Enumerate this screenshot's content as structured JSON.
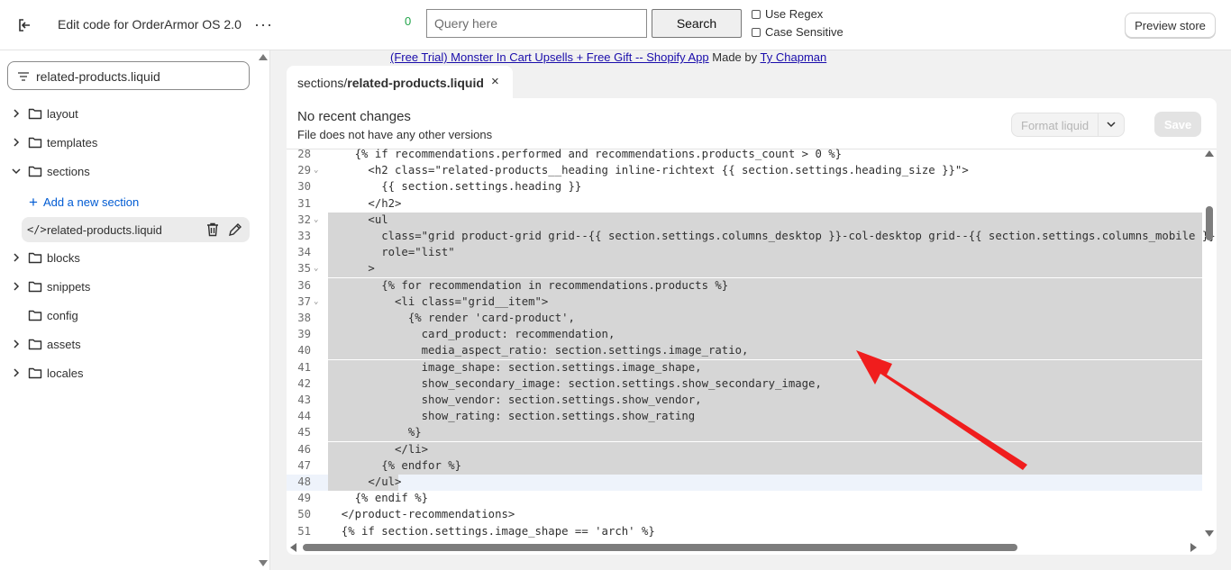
{
  "header": {
    "title": "Edit code for OrderArmor OS 2.0",
    "more": "···",
    "result_count": "0",
    "query_placeholder": "Query here",
    "search_label": "Search",
    "use_regex": "Use Regex",
    "case_sensitive": "Case Sensitive",
    "preview_label": "Preview store"
  },
  "sidebar": {
    "filter_value": "related-products.liquid",
    "add_section": "Add a new section",
    "active_file": "related-products.liquid",
    "folders": [
      {
        "label": "layout",
        "expanded": false
      },
      {
        "label": "templates",
        "expanded": false
      },
      {
        "label": "sections",
        "expanded": true
      },
      {
        "label": "blocks",
        "expanded": false
      },
      {
        "label": "snippets",
        "expanded": false
      },
      {
        "label": "config",
        "expanded": false
      },
      {
        "label": "assets",
        "expanded": false
      },
      {
        "label": "locales",
        "expanded": false
      }
    ]
  },
  "promo": {
    "link_text": "(Free Trial) Monster In Cart Upsells + Free Gift -- Shopify App",
    "made_by": "Made by",
    "author": "Ty Chapman"
  },
  "tab": {
    "folder": "sections/",
    "file": "related-products.liquid",
    "close": "×"
  },
  "editor": {
    "heading": "No recent changes",
    "subheading": "File does not have any other versions",
    "format_label": "Format liquid",
    "save_label": "Save",
    "lines": [
      {
        "n": "28",
        "code": "    {% if recommendations.performed and recommendations.products_count > 0 %}"
      },
      {
        "n": "29",
        "code": "      <h2 class=\"related-products__heading inline-richtext {{ section.settings.heading_size }}\">"
      },
      {
        "n": "30",
        "code": "        {{ section.settings.heading }}"
      },
      {
        "n": "31",
        "code": "      </h2>"
      },
      {
        "n": "32",
        "code": "      <ul"
      },
      {
        "n": "33",
        "code": "        class=\"grid product-grid grid--{{ section.settings.columns_desktop }}-col-desktop grid--{{ section.settings.columns_mobile }}-col"
      },
      {
        "n": "34",
        "code": "        role=\"list\""
      },
      {
        "n": "35",
        "code": "      >"
      },
      {
        "n": "36",
        "code": "        {% for recommendation in recommendations.products %}"
      },
      {
        "n": "37",
        "code": "          <li class=\"grid__item\">"
      },
      {
        "n": "38",
        "code": "            {% render 'card-product',"
      },
      {
        "n": "39",
        "code": "              card_product: recommendation,"
      },
      {
        "n": "40",
        "code": "              media_aspect_ratio: section.settings.image_ratio,"
      },
      {
        "n": "41",
        "code": "              image_shape: section.settings.image_shape,"
      },
      {
        "n": "42",
        "code": "              show_secondary_image: section.settings.show_secondary_image,"
      },
      {
        "n": "43",
        "code": "              show_vendor: section.settings.show_vendor,"
      },
      {
        "n": "44",
        "code": "              show_rating: section.settings.show_rating"
      },
      {
        "n": "45",
        "code": "            %}"
      },
      {
        "n": "46",
        "code": "          </li>"
      },
      {
        "n": "47",
        "code": "        {% endfor %}"
      },
      {
        "n": "48",
        "code": "      </ul>"
      },
      {
        "n": "49",
        "code": "    {% endif %}"
      },
      {
        "n": "50",
        "code": "  </product-recommendations>"
      },
      {
        "n": "51",
        "code": "  {% if section.settings.image_shape == 'arch' %}"
      }
    ]
  },
  "colors": {
    "accent": "#005bd3",
    "selection": "#d6d6d6",
    "arrow": "#f01d1d"
  }
}
